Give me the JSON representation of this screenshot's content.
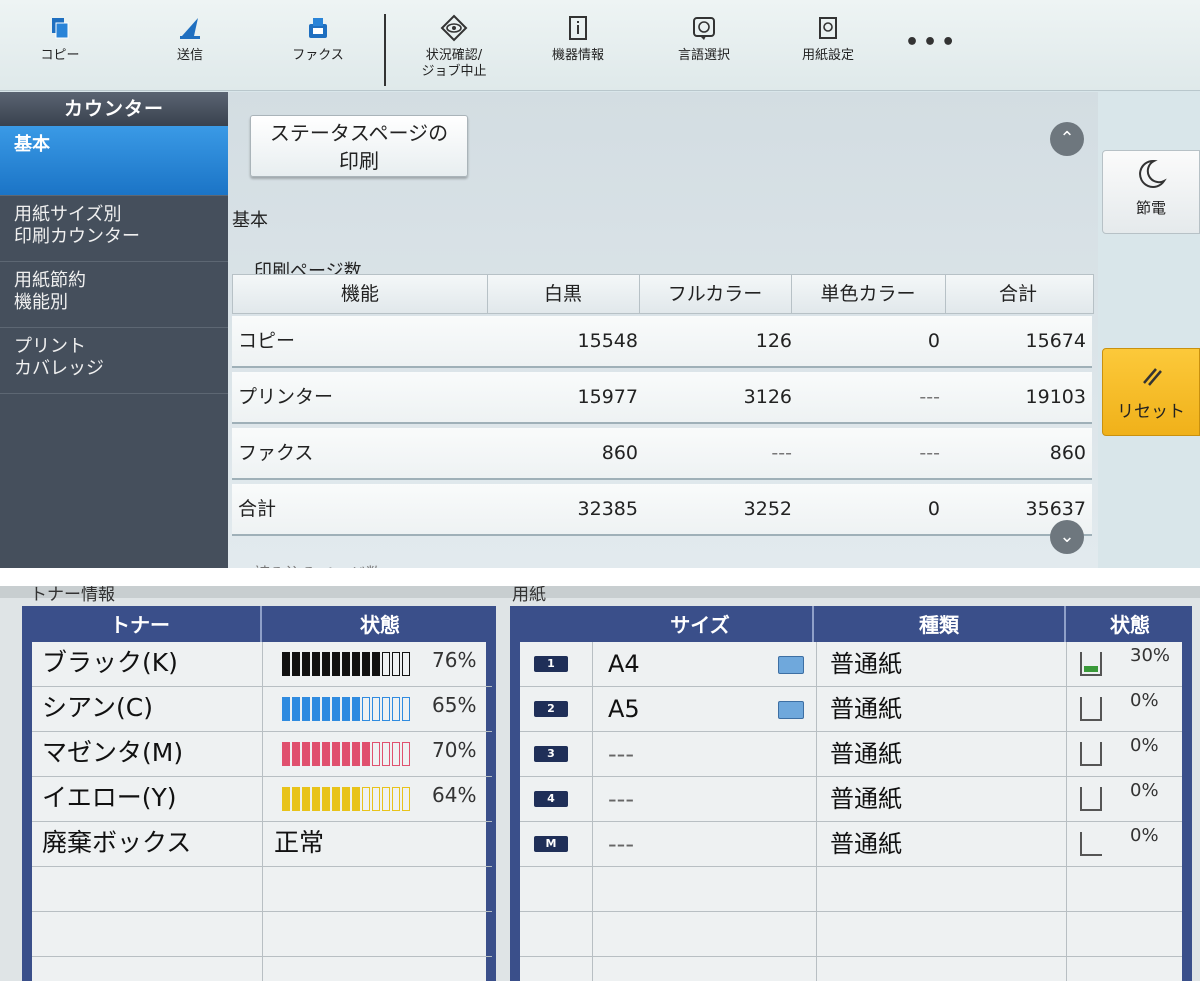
{
  "toolbar": {
    "items": [
      {
        "label": "コピー",
        "icon": "copy-icon"
      },
      {
        "label": "送信",
        "icon": "send-icon"
      },
      {
        "label": "ファクス",
        "icon": "fax-icon"
      },
      {
        "label": "状況確認/\nジョブ中止",
        "icon": "eye-icon"
      },
      {
        "label": "機器情報",
        "icon": "info-icon"
      },
      {
        "label": "言語選択",
        "icon": "language-icon"
      },
      {
        "label": "用紙設定",
        "icon": "paper-settings-icon"
      }
    ],
    "more": "•••"
  },
  "sidebar": {
    "header": "カウンター",
    "items": [
      {
        "label": "基本",
        "active": true
      },
      {
        "label": "用紙サイズ別\n印刷カウンター"
      },
      {
        "label": "用紙節約\n機能別"
      },
      {
        "label": "プリント\nカバレッジ"
      }
    ]
  },
  "main": {
    "status_button": "ステータスページの\n印刷",
    "section_title": "基本",
    "sub_title": "印刷ページ数",
    "table": {
      "headers": [
        "機能",
        "白黒",
        "フルカラー",
        "単色カラー",
        "合計"
      ],
      "rows": [
        [
          "コピー",
          "15548",
          "126",
          "0",
          "15674"
        ],
        [
          "プリンター",
          "15977",
          "3126",
          "---",
          "19103"
        ],
        [
          "ファクス",
          "860",
          "---",
          "---",
          "860"
        ],
        [
          "合計",
          "32385",
          "3252",
          "0",
          "35637"
        ]
      ]
    },
    "next_section": "読み込みページ数"
  },
  "side_buttons": {
    "sleep": "節電",
    "reset": "リセット"
  },
  "bottom": {
    "toner_section_label": "トナー情報",
    "paper_section_label": "用紙",
    "toner_headers": [
      "トナー",
      "状態"
    ],
    "toner": [
      {
        "name": "ブラック(K)",
        "percent": "76%",
        "level": 0.76,
        "color": "#111111"
      },
      {
        "name": "シアン(C)",
        "percent": "65%",
        "level": 0.65,
        "color": "#2f8be0"
      },
      {
        "name": "マゼンタ(M)",
        "percent": "70%",
        "level": 0.7,
        "color": "#e0506e"
      },
      {
        "name": "イエロー(Y)",
        "percent": "64%",
        "level": 0.64,
        "color": "#e8c31a"
      }
    ],
    "waste": {
      "name": "廃棄ボックス",
      "status": "正常"
    },
    "paper_headers": [
      "サイズ",
      "種類",
      "状態"
    ],
    "paper": [
      {
        "tray": "1",
        "size": "A4",
        "type": "普通紙",
        "percent": "30%",
        "level": 0.3
      },
      {
        "tray": "2",
        "size": "A5",
        "type": "普通紙",
        "percent": "0%",
        "level": 0.0
      },
      {
        "tray": "3",
        "size": "---",
        "type": "普通紙",
        "percent": "0%",
        "level": 0.0
      },
      {
        "tray": "4",
        "size": "---",
        "type": "普通紙",
        "percent": "0%",
        "level": 0.0
      },
      {
        "tray": "M",
        "size": "---",
        "type": "普通紙",
        "percent": "0%",
        "level": 0.0
      }
    ]
  }
}
